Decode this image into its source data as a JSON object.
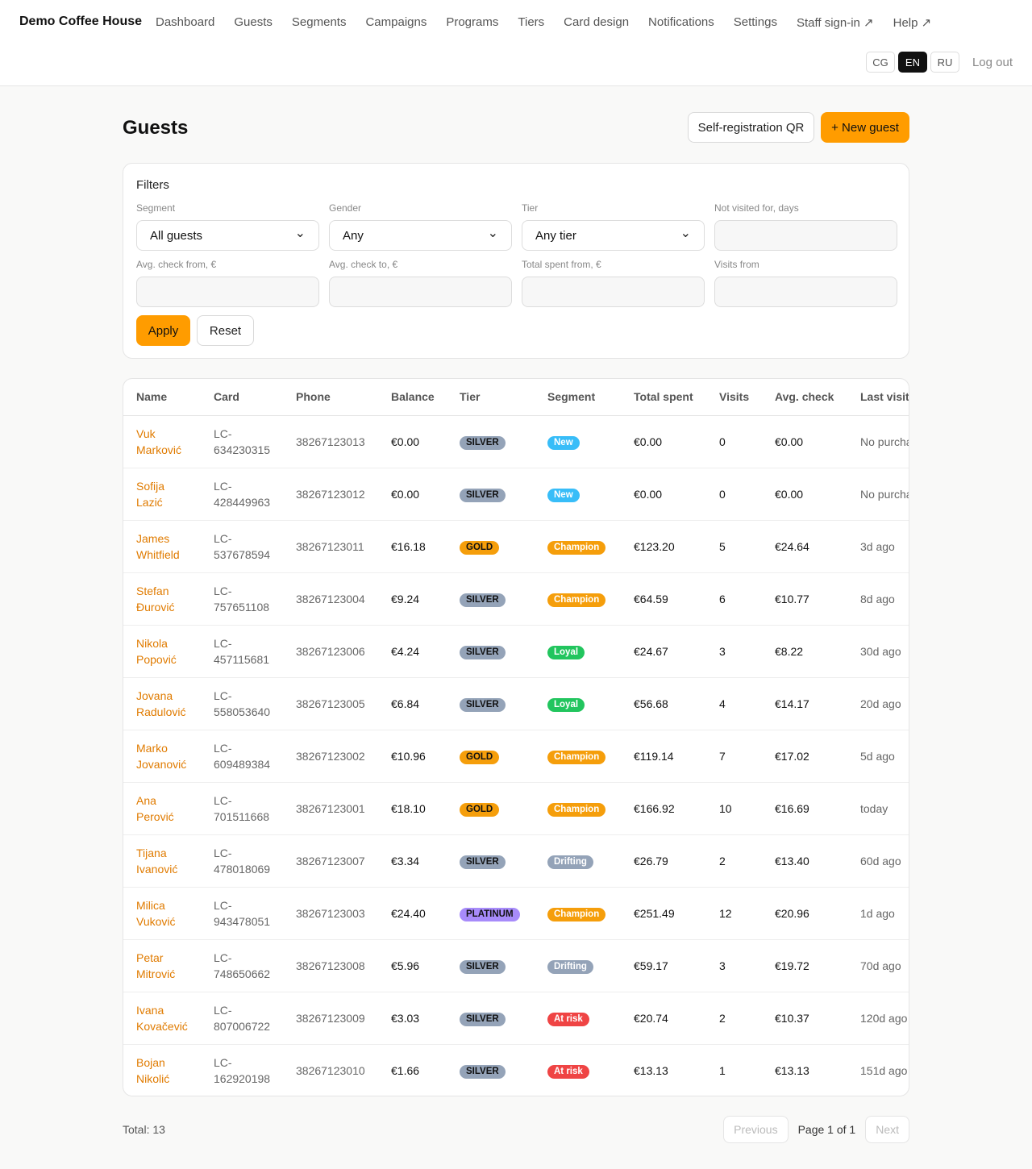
{
  "app": {
    "brand": "Demo Coffee House"
  },
  "nav": [
    {
      "label": "Dashboard",
      "name": "nav-dashboard"
    },
    {
      "label": "Guests",
      "name": "nav-guests"
    },
    {
      "label": "Segments",
      "name": "nav-segments"
    },
    {
      "label": "Campaigns",
      "name": "nav-campaigns"
    },
    {
      "label": "Programs",
      "name": "nav-programs"
    },
    {
      "label": "Tiers",
      "name": "nav-tiers"
    },
    {
      "label": "Card design",
      "name": "nav-card-design"
    },
    {
      "label": "Notifications",
      "name": "nav-notifications"
    },
    {
      "label": "Settings",
      "name": "nav-settings"
    },
    {
      "label": "Staff sign-in ↗",
      "name": "nav-staff-sign-in"
    },
    {
      "label": "Help ↗",
      "name": "nav-help"
    }
  ],
  "langs": [
    {
      "label": "CG",
      "active": false
    },
    {
      "label": "EN",
      "active": true
    },
    {
      "label": "RU",
      "active": false
    }
  ],
  "logout": "Log out",
  "page": {
    "title": "Guests",
    "qr_button": "Self-registration QR",
    "new_button": "+ New guest"
  },
  "filters": {
    "title": "Filters",
    "fields": [
      {
        "label": "Segment",
        "value": "All guests",
        "type": "select",
        "name": "segment-select"
      },
      {
        "label": "Gender",
        "value": "Any",
        "type": "select",
        "name": "gender-select"
      },
      {
        "label": "Tier",
        "value": "Any tier",
        "type": "select",
        "name": "tier-select"
      },
      {
        "label": "Not visited for, days",
        "value": "",
        "type": "input",
        "name": "not-visited-input"
      },
      {
        "label": "Avg. check from, €",
        "value": "",
        "type": "input",
        "name": "avg-check-from-input"
      },
      {
        "label": "Avg. check to, €",
        "value": "",
        "type": "input",
        "name": "avg-check-to-input"
      },
      {
        "label": "Total spent from, €",
        "value": "",
        "type": "input",
        "name": "total-spent-from-input"
      },
      {
        "label": "Visits from",
        "value": "",
        "type": "input",
        "name": "visits-from-input"
      }
    ],
    "apply": "Apply",
    "reset": "Reset"
  },
  "badge_colors": {
    "SILVER": {
      "bg": "#94a3b8",
      "fg": "#111111"
    },
    "GOLD": {
      "bg": "#f59e0b",
      "fg": "#111111"
    },
    "PLATINUM": {
      "bg": "#a78bfa",
      "fg": "#111111"
    },
    "New": {
      "bg": "#38bdf8",
      "fg": "#ffffff"
    },
    "Champion": {
      "bg": "#f59e0b",
      "fg": "#ffffff"
    },
    "Loyal": {
      "bg": "#22c55e",
      "fg": "#ffffff"
    },
    "Drifting": {
      "bg": "#94a3b8",
      "fg": "#ffffff"
    },
    "At risk": {
      "bg": "#ef4444",
      "fg": "#ffffff"
    }
  },
  "table": {
    "columns": [
      "Name",
      "Card",
      "Phone",
      "Balance",
      "Tier",
      "Segment",
      "Total spent",
      "Visits",
      "Avg. check",
      "Last visit"
    ],
    "rows": [
      {
        "first": "Vuk",
        "last": "Marković",
        "card1": "LC-",
        "card2": "634230315",
        "phone": "38267123013",
        "balance": "€0.00",
        "tier": "SILVER",
        "segment": "New",
        "total": "€0.00",
        "visits": "0",
        "avg": "€0.00",
        "last_visit": "No purchases"
      },
      {
        "first": "Sofija",
        "last": "Lazić",
        "card1": "LC-",
        "card2": "428449963",
        "phone": "38267123012",
        "balance": "€0.00",
        "tier": "SILVER",
        "segment": "New",
        "total": "€0.00",
        "visits": "0",
        "avg": "€0.00",
        "last_visit": "No purchases"
      },
      {
        "first": "James",
        "last": "Whitfield",
        "card1": "LC-",
        "card2": "537678594",
        "phone": "38267123011",
        "balance": "€16.18",
        "tier": "GOLD",
        "segment": "Champion",
        "total": "€123.20",
        "visits": "5",
        "avg": "€24.64",
        "last_visit": "3d ago"
      },
      {
        "first": "Stefan",
        "last": "Đurović",
        "card1": "LC-",
        "card2": "757651108",
        "phone": "38267123004",
        "balance": "€9.24",
        "tier": "SILVER",
        "segment": "Champion",
        "total": "€64.59",
        "visits": "6",
        "avg": "€10.77",
        "last_visit": "8d ago"
      },
      {
        "first": "Nikola",
        "last": "Popović",
        "card1": "LC-",
        "card2": "457115681",
        "phone": "38267123006",
        "balance": "€4.24",
        "tier": "SILVER",
        "segment": "Loyal",
        "total": "€24.67",
        "visits": "3",
        "avg": "€8.22",
        "last_visit": "30d ago"
      },
      {
        "first": "Jovana",
        "last": "Radulović",
        "card1": "LC-",
        "card2": "558053640",
        "phone": "38267123005",
        "balance": "€6.84",
        "tier": "SILVER",
        "segment": "Loyal",
        "total": "€56.68",
        "visits": "4",
        "avg": "€14.17",
        "last_visit": "20d ago"
      },
      {
        "first": "Marko",
        "last": "Jovanović",
        "card1": "LC-",
        "card2": "609489384",
        "phone": "38267123002",
        "balance": "€10.96",
        "tier": "GOLD",
        "segment": "Champion",
        "total": "€119.14",
        "visits": "7",
        "avg": "€17.02",
        "last_visit": "5d ago"
      },
      {
        "first": "Ana",
        "last": "Perović",
        "card1": "LC-",
        "card2": "701511668",
        "phone": "38267123001",
        "balance": "€18.10",
        "tier": "GOLD",
        "segment": "Champion",
        "total": "€166.92",
        "visits": "10",
        "avg": "€16.69",
        "last_visit": "today"
      },
      {
        "first": "Tijana",
        "last": "Ivanović",
        "card1": "LC-",
        "card2": "478018069",
        "phone": "38267123007",
        "balance": "€3.34",
        "tier": "SILVER",
        "segment": "Drifting",
        "total": "€26.79",
        "visits": "2",
        "avg": "€13.40",
        "last_visit": "60d ago"
      },
      {
        "first": "Milica",
        "last": "Vuković",
        "card1": "LC-",
        "card2": "943478051",
        "phone": "38267123003",
        "balance": "€24.40",
        "tier": "PLATINUM",
        "segment": "Champion",
        "total": "€251.49",
        "visits": "12",
        "avg": "€20.96",
        "last_visit": "1d ago"
      },
      {
        "first": "Petar",
        "last": "Mitrović",
        "card1": "LC-",
        "card2": "748650662",
        "phone": "38267123008",
        "balance": "€5.96",
        "tier": "SILVER",
        "segment": "Drifting",
        "total": "€59.17",
        "visits": "3",
        "avg": "€19.72",
        "last_visit": "70d ago"
      },
      {
        "first": "Ivana",
        "last": "Kovačević",
        "card1": "LC-",
        "card2": "807006722",
        "phone": "38267123009",
        "balance": "€3.03",
        "tier": "SILVER",
        "segment": "At risk",
        "total": "€20.74",
        "visits": "2",
        "avg": "€10.37",
        "last_visit": "120d ago"
      },
      {
        "first": "Bojan",
        "last": "Nikolić",
        "card1": "LC-",
        "card2": "162920198",
        "phone": "38267123010",
        "balance": "€1.66",
        "tier": "SILVER",
        "segment": "At risk",
        "total": "€13.13",
        "visits": "1",
        "avg": "€13.13",
        "last_visit": "151d ago"
      }
    ]
  },
  "footer": {
    "total": "Total: 13",
    "previous": "Previous",
    "page_info": "Page 1 of 1",
    "next": "Next"
  }
}
